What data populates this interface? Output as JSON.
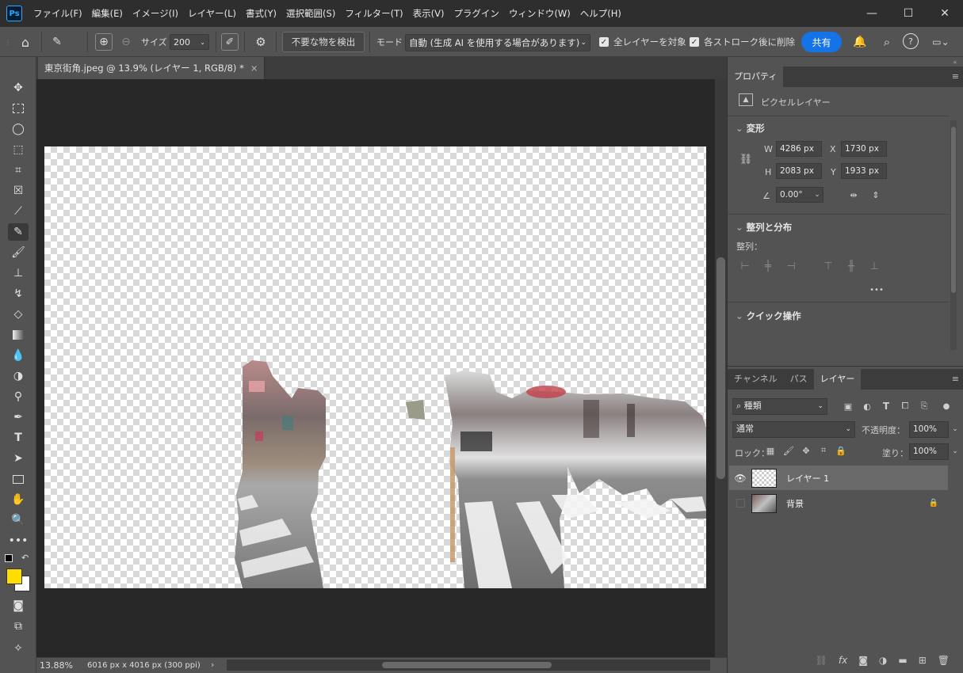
{
  "app": {
    "logo": "Ps"
  },
  "menu": [
    "ファイル(F)",
    "編集(E)",
    "イメージ(I)",
    "レイヤー(L)",
    "書式(Y)",
    "選択範囲(S)",
    "フィルター(T)",
    "表示(V)",
    "プラグイン",
    "ウィンドウ(W)",
    "ヘルプ(H)"
  ],
  "window_controls": {
    "minimize": "—",
    "maximize": "☐",
    "close": "✕"
  },
  "options": {
    "size_label": "サイズ",
    "size_value": "200",
    "detect_button": "不要な物を検出",
    "mode_label": "モード",
    "mode_value": "自動 (生成 AI を使用する場合があります)",
    "all_layers": "全レイヤーを対象",
    "delete_after_stroke": "各ストローク後に削除",
    "share": "共有"
  },
  "document_tab": {
    "title": "東京街角.jpeg @ 13.9% (レイヤー 1, RGB/8) *",
    "close": "×"
  },
  "status": {
    "zoom": "13.88%",
    "info": "6016 px x 4016 px (300 ppi)"
  },
  "properties": {
    "tab": "プロパティ",
    "layer_kind": "ピクセルレイヤー",
    "transform_title": "変形",
    "w_label": "W",
    "w_value": "4286 px",
    "h_label": "H",
    "h_value": "2083 px",
    "x_label": "X",
    "x_value": "1730 px",
    "y_label": "Y",
    "y_value": "1933 px",
    "angle_value": "0.00°",
    "align_title": "整列と分布",
    "align_label": "整列：",
    "more": "•••",
    "quick_title": "クイック操作"
  },
  "layers_panel": {
    "tabs": [
      "チャンネル",
      "パス",
      "レイヤー"
    ],
    "filter_kind": "種類",
    "blend_mode": "通常",
    "opacity_label": "不透明度：",
    "opacity_value": "100%",
    "lock_label": "ロック：",
    "fill_label": "塗り：",
    "fill_value": "100%",
    "layers": [
      {
        "name": "レイヤー 1",
        "visible": true,
        "selected": true
      },
      {
        "name": "背景",
        "visible": false,
        "locked": true
      }
    ]
  },
  "colors": {
    "foreground": "#ffdd00",
    "background": "#ffffff",
    "accent": "#1473e6"
  }
}
